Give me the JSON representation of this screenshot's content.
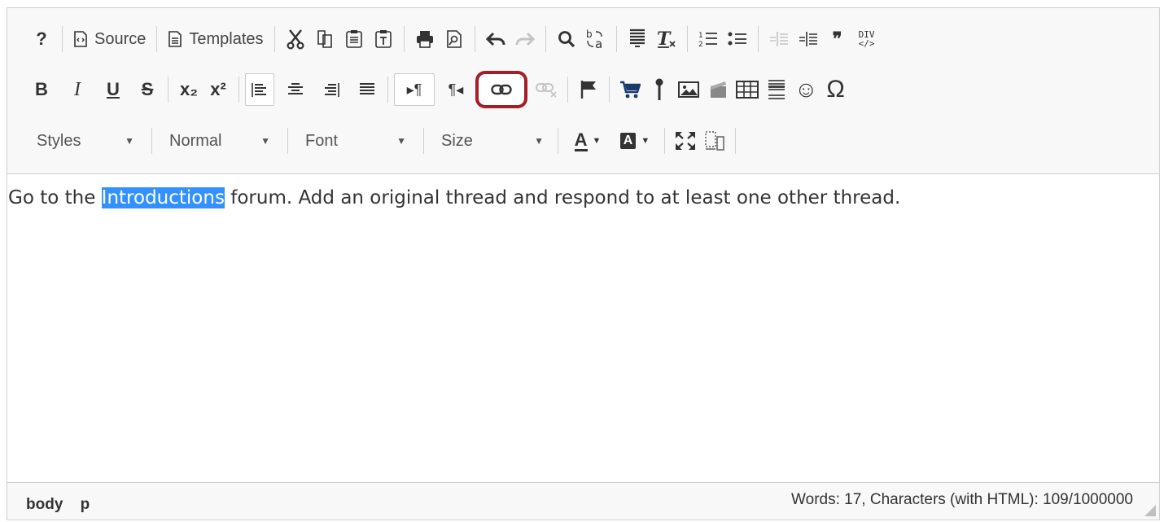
{
  "toolbar": {
    "source_label": "Source",
    "templates_label": "Templates",
    "styles_label": "Styles",
    "format_label": "Normal",
    "font_label": "Font",
    "size_label": "Size",
    "help_glyph": "?",
    "bold_glyph": "B",
    "italic_glyph": "I",
    "underline_glyph": "U",
    "strike_glyph": "S",
    "subscript_glyph": "x₂",
    "superscript_glyph": "x²",
    "blockquote_glyph": "❞",
    "omega_glyph": "Ω",
    "smiley_glyph": "☺",
    "text_color_glyph": "A",
    "bg_color_glyph": "A",
    "div_glyph": "DIV"
  },
  "content": {
    "text_before": "Go to the ",
    "selected_text": "Introductions",
    "text_after": " forum. Add an original thread and respond to at least one other thread."
  },
  "status": {
    "path_items": [
      "body",
      "p"
    ],
    "counts": "Words: 17, Characters (with HTML): 109/1000000"
  },
  "colors": {
    "highlight": "#3390ff",
    "link_outline": "#a51d25"
  },
  "icons": [
    "help-icon",
    "source-icon",
    "templates-icon",
    "cut-icon",
    "copy-icon",
    "paste-icon",
    "paste-text-icon",
    "print-icon",
    "preview-icon",
    "undo-icon",
    "redo-icon",
    "find-icon",
    "replace-icon",
    "select-all-icon",
    "remove-format-icon",
    "numbered-list-icon",
    "bulleted-list-icon",
    "outdent-icon",
    "indent-icon",
    "blockquote-icon",
    "div-icon",
    "align-left-icon",
    "align-center-icon",
    "align-right-icon",
    "justify-icon",
    "ltr-icon",
    "rtl-icon",
    "link-icon",
    "unlink-icon",
    "anchor-icon",
    "cart-icon",
    "mic-icon",
    "image-icon",
    "video-icon",
    "table-icon",
    "horizontal-rule-icon",
    "smiley-icon",
    "omega-icon",
    "maximize-icon",
    "show-blocks-icon"
  ]
}
